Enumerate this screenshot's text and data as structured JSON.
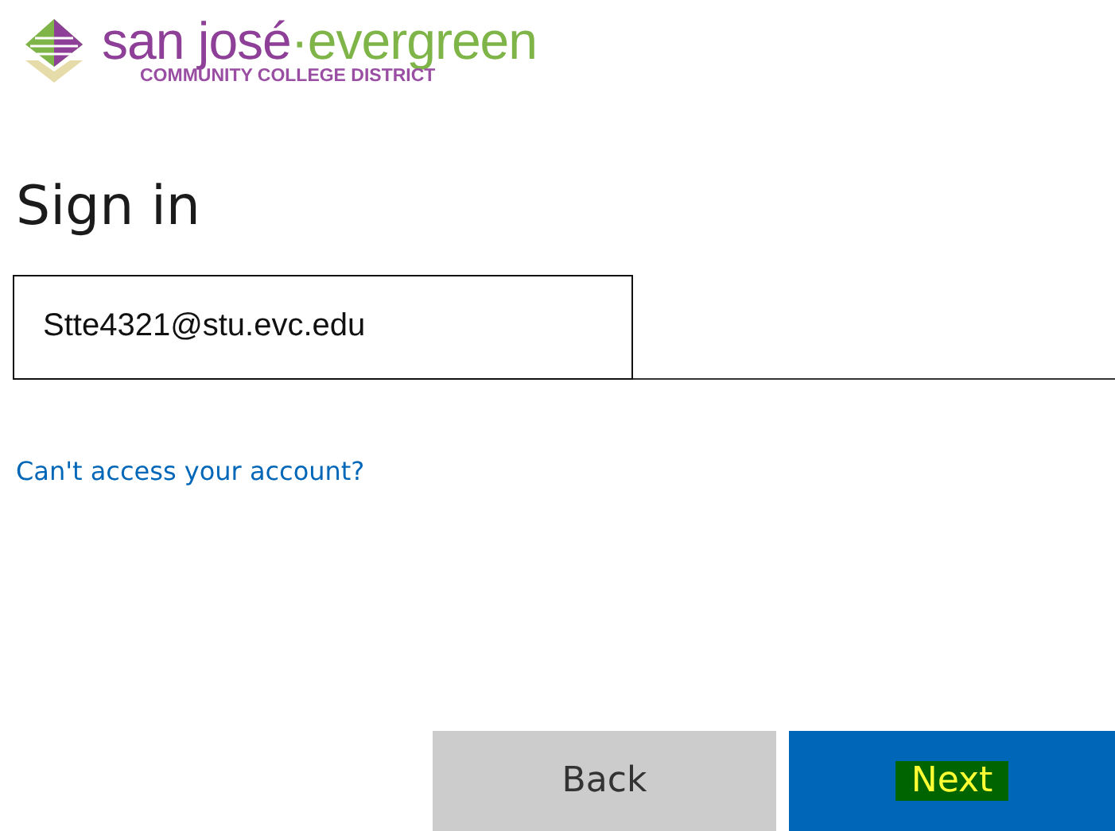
{
  "logo": {
    "name_primary": "san josé",
    "name_secondary": "·evergreen",
    "subtitle": "COMMUNITY COLLEGE DISTRICT"
  },
  "heading": "Sign in",
  "email_field": {
    "value": "Stte4321@stu.evc.edu"
  },
  "help_link": "Can't access your account?",
  "buttons": [
    {
      "label": "Back",
      "kind": "secondary",
      "highlighted": false
    },
    {
      "label": "Next",
      "kind": "primary",
      "highlighted": true
    }
  ]
}
